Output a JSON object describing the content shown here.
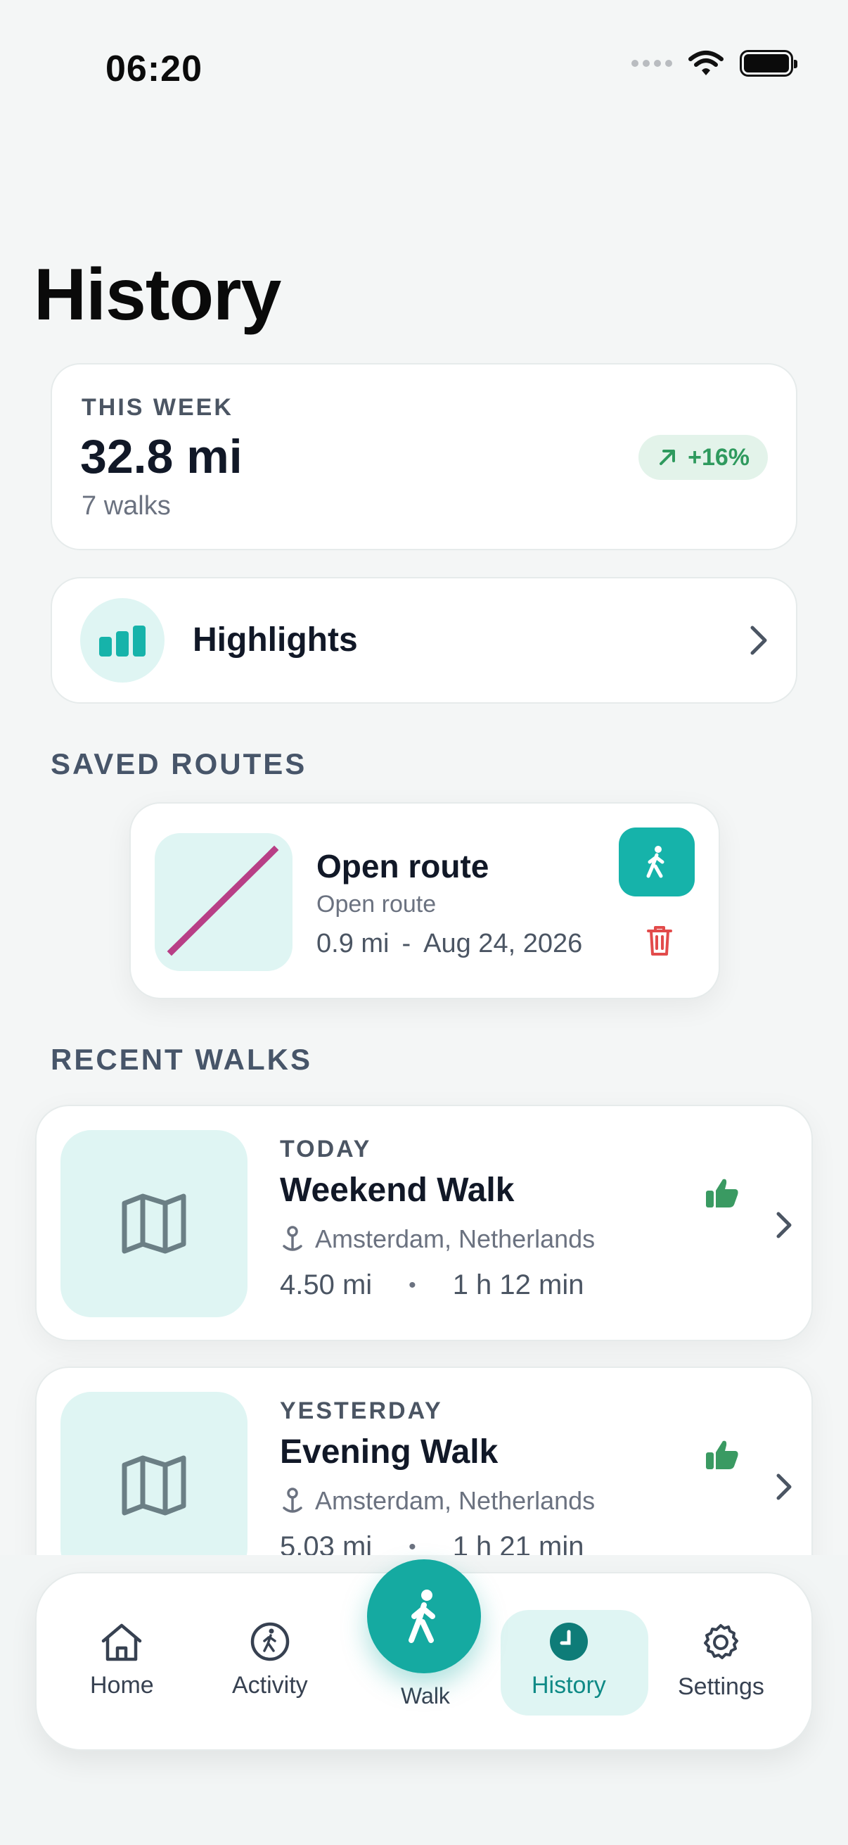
{
  "status": {
    "time": "06:20"
  },
  "page": {
    "title": "History"
  },
  "week": {
    "label": "THIS WEEK",
    "distance": "32.8 mi",
    "walks": "7 walks",
    "trend": "+16%"
  },
  "highlights": {
    "label": "Highlights"
  },
  "sections": {
    "saved_routes": "SAVED ROUTES",
    "recent_walks": "RECENT WALKS"
  },
  "saved_route": {
    "name": "Open route",
    "subtitle": "Open route",
    "distance": "0.9 mi",
    "dash": "-",
    "date": "Aug 24, 2026"
  },
  "walks": [
    {
      "day": "TODAY",
      "name": "Weekend Walk",
      "location": "Amsterdam, Netherlands",
      "distance": "4.50 mi",
      "duration": "1 h 12 min"
    },
    {
      "day": "YESTERDAY",
      "name": "Evening Walk",
      "location": "Amsterdam, Netherlands",
      "distance": "5.03 mi",
      "duration": "1 h 21 min"
    }
  ],
  "nav": {
    "home": "Home",
    "activity": "Activity",
    "walk": "Walk",
    "history": "History",
    "settings": "Settings"
  },
  "colors": {
    "accent": "#16b3aa",
    "route_line": "#b83f86",
    "success": "#2f9a5e",
    "danger": "#e24b4b"
  }
}
